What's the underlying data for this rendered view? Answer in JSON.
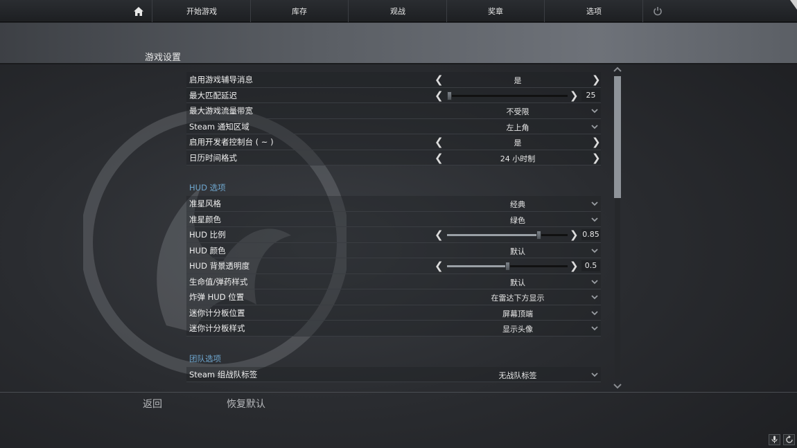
{
  "nav": {
    "tabs": [
      "开始游戏",
      "库存",
      "观战",
      "奖章",
      "选项"
    ]
  },
  "page": {
    "title": "游戏设置"
  },
  "rows_general": [
    {
      "label": "启用游戏辅导消息",
      "value": "是",
      "control": "arrows"
    },
    {
      "label": "最大匹配延迟",
      "value": "25",
      "control": "slider",
      "fraction": 0.0
    },
    {
      "label": "最大游戏流量带宽",
      "value": "不受限",
      "control": "dropdown"
    },
    {
      "label": "Steam 通知区域",
      "value": "左上角",
      "control": "dropdown"
    },
    {
      "label": "启用开发者控制台 ( ~ )",
      "value": "是",
      "control": "arrows"
    },
    {
      "label": "日历时间格式",
      "value": "24 小时制",
      "control": "arrows"
    }
  ],
  "section_hud": {
    "title": "HUD 选项"
  },
  "rows_hud": [
    {
      "label": "准星风格",
      "value": "经典",
      "control": "dropdown"
    },
    {
      "label": "准星颜色",
      "value": "绿色",
      "control": "dropdown"
    },
    {
      "label": "HUD 比例",
      "value": "0.85",
      "control": "slider",
      "fraction": 0.77
    },
    {
      "label": "HUD 颜色",
      "value": "默认",
      "control": "dropdown"
    },
    {
      "label": "HUD 背景透明度",
      "value": "0.5",
      "control": "slider",
      "fraction": 0.5
    },
    {
      "label": "生命值/弹药样式",
      "value": "默认",
      "control": "dropdown"
    },
    {
      "label": "炸弹 HUD 位置",
      "value": "在雷达下方显示",
      "control": "dropdown"
    },
    {
      "label": "迷你计分板位置",
      "value": "屏幕顶端",
      "control": "dropdown"
    },
    {
      "label": "迷你计分板样式",
      "value": "显示头像",
      "control": "dropdown"
    }
  ],
  "section_team": {
    "title": "团队选项"
  },
  "rows_team": [
    {
      "label": "Steam 组战队标签",
      "value": "无战队标签",
      "control": "dropdown"
    }
  ],
  "footer": {
    "back_label": "返回",
    "reset_label": "恢复默认"
  },
  "scrollbar": {
    "position_fraction": 0.0
  },
  "icons": {
    "home": "home-icon",
    "power": "power-icon",
    "mic": "microphone-icon",
    "sync": "refresh-icon"
  }
}
